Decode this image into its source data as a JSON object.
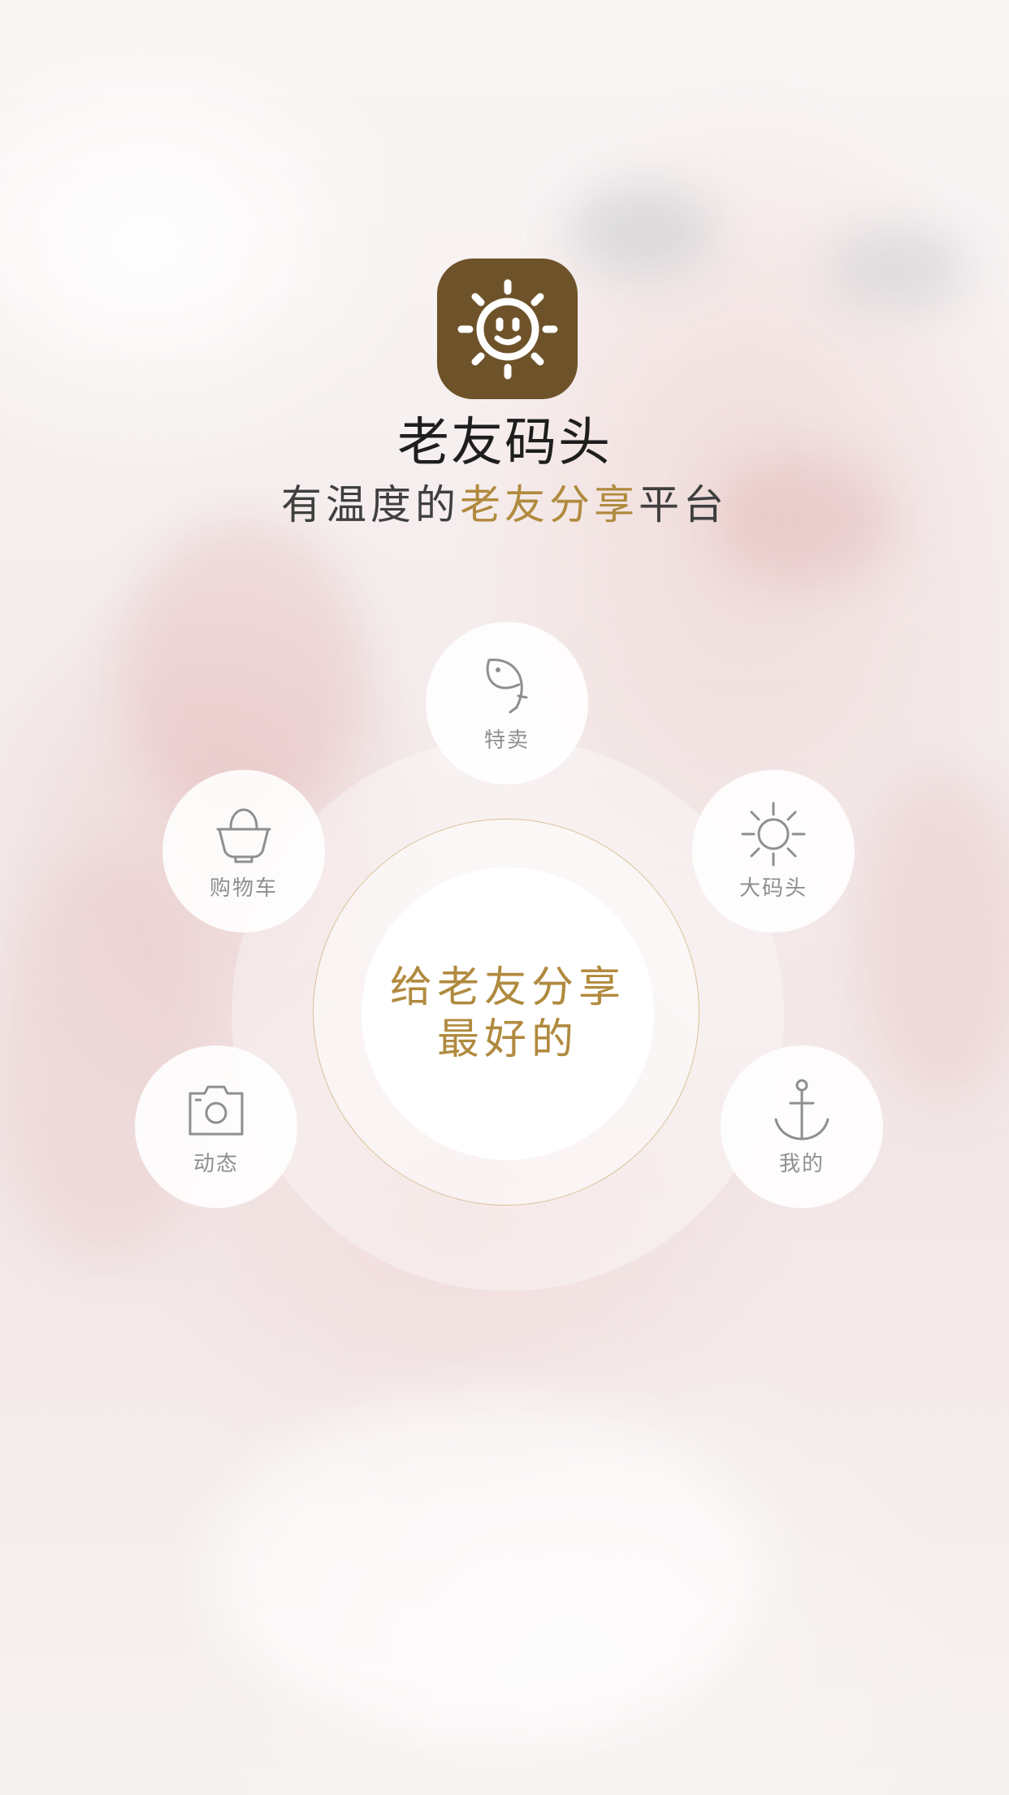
{
  "app": {
    "title": "老友码头",
    "tagline_prefix": "有温度的",
    "tagline_accent": "老友分享",
    "tagline_suffix": "平台",
    "logo_icon": "smiling-sun-icon",
    "logo_color": "#6e5229",
    "accent_color": "#b08a3e"
  },
  "center": {
    "line1": "给老友分享",
    "line2": "最好的"
  },
  "menu": [
    {
      "key": "special",
      "label": "特卖",
      "icon": "fish-icon"
    },
    {
      "key": "cart",
      "label": "购物车",
      "icon": "basket-icon"
    },
    {
      "key": "wharf",
      "label": "大码头",
      "icon": "sun-icon"
    },
    {
      "key": "moments",
      "label": "动态",
      "icon": "camera-icon"
    },
    {
      "key": "mine",
      "label": "我的",
      "icon": "anchor-icon"
    }
  ]
}
